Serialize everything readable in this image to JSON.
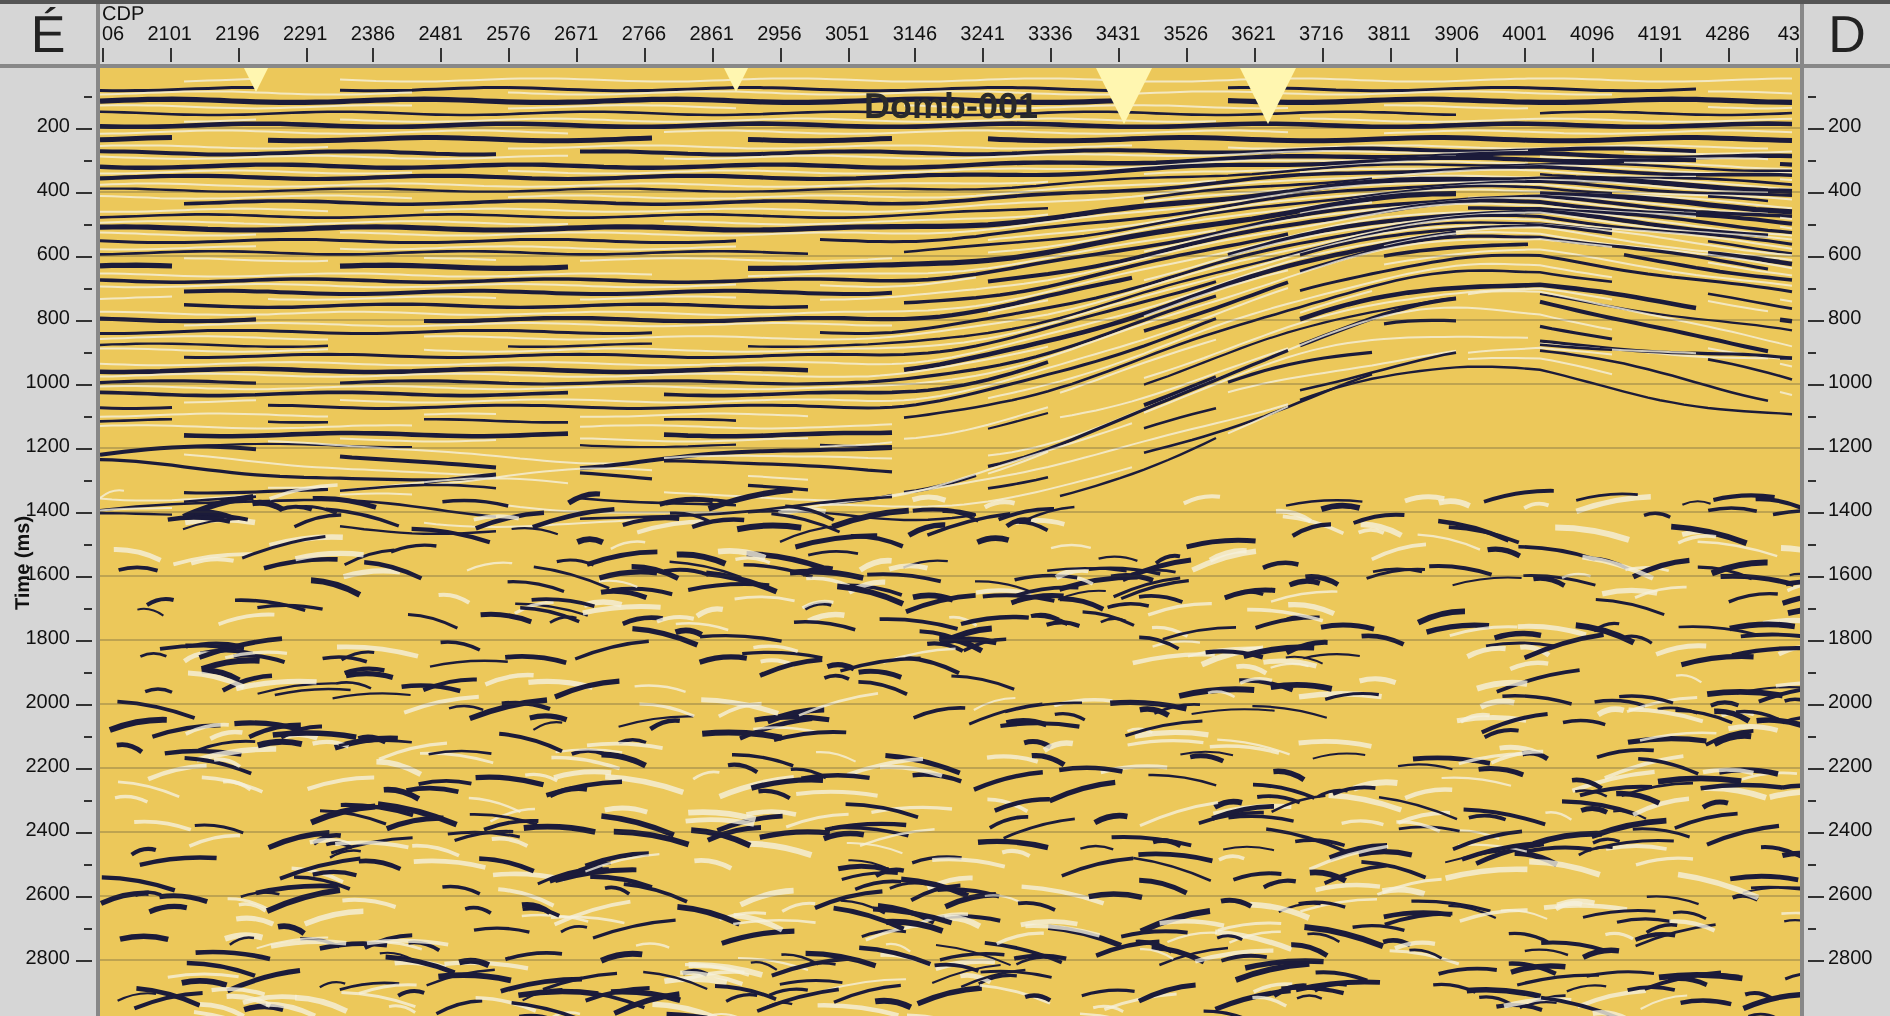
{
  "corner_left": "É",
  "corner_right": "D",
  "cdp_axis": {
    "label": "CDP",
    "ticks": [
      "06",
      "2101",
      "2196",
      "2291",
      "2386",
      "2481",
      "2576",
      "2671",
      "2766",
      "2861",
      "2956",
      "3051",
      "3146",
      "3241",
      "3336",
      "3431",
      "3526",
      "3621",
      "3716",
      "3811",
      "3906",
      "4001",
      "4096",
      "4191",
      "4286",
      "43"
    ]
  },
  "time_axis": {
    "label": "Time (ms)",
    "ticks": [
      "200",
      "400",
      "600",
      "800",
      "1000",
      "1200",
      "1400",
      "1600",
      "1800",
      "2000",
      "2200",
      "2400",
      "2600",
      "2800"
    ]
  },
  "right_time_axis": {
    "ticks": [
      "200",
      "400",
      "600",
      "800",
      "1000",
      "1200",
      "1400",
      "1600",
      "1800",
      "2000",
      "2200",
      "2400",
      "2600",
      "2800"
    ]
  },
  "section": {
    "title": "Domb-001"
  }
}
